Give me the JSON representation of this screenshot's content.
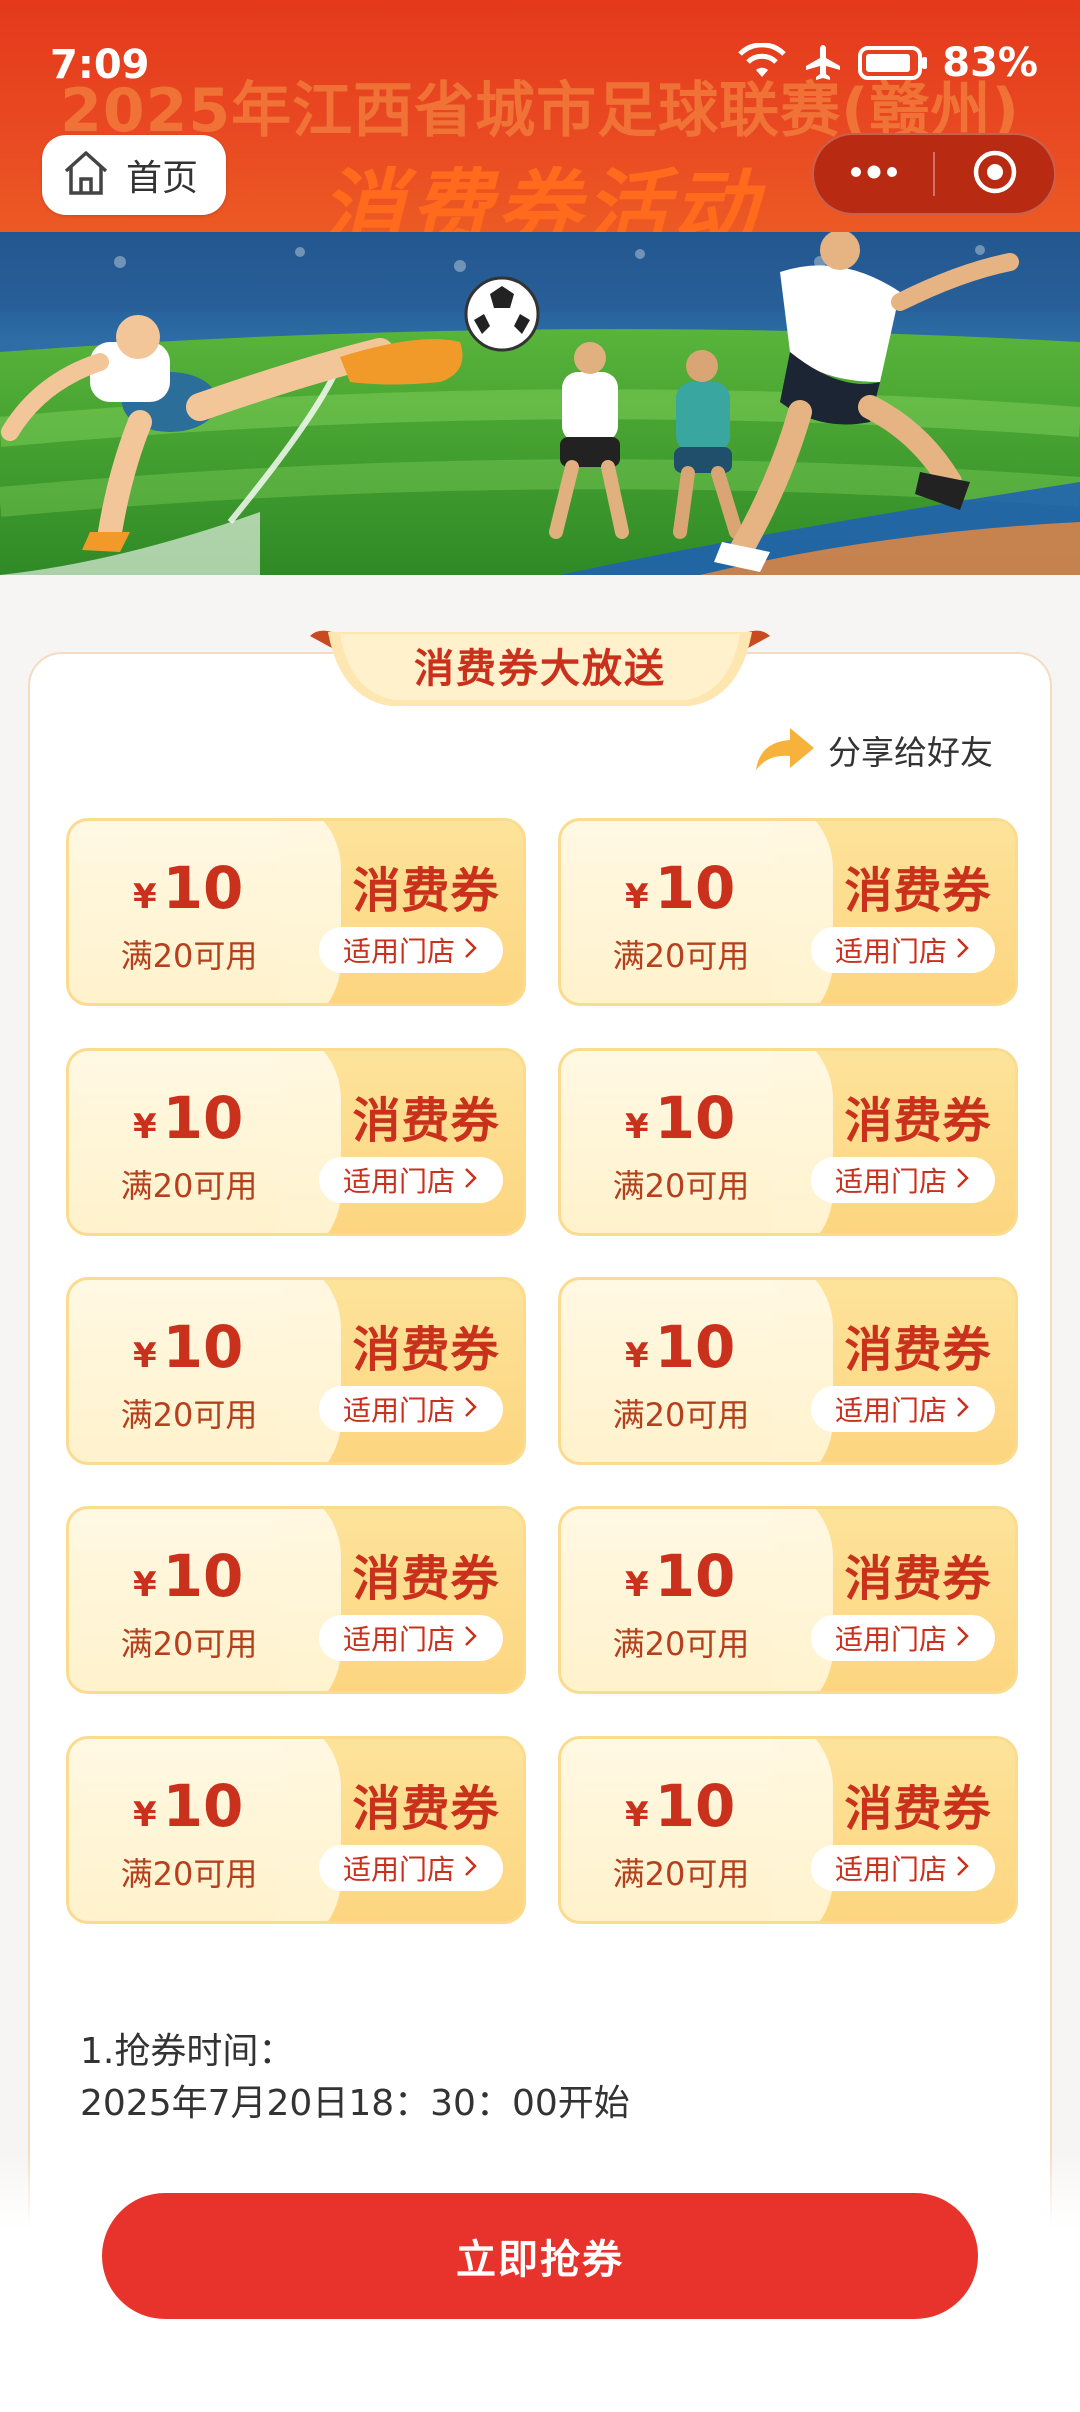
{
  "status_bar": {
    "time": "7:09",
    "battery": "83%"
  },
  "header": {
    "title_line1": "2025年江西省城市足球联赛(赣州)",
    "title_line2": "消费券活动",
    "home_label": "首页"
  },
  "colors": {
    "primary_red": "#e8332c",
    "banner_orange": "#e94a22",
    "coupon_gold": "#fdd580",
    "coupon_text": "#c9311c"
  },
  "section": {
    "ribbon_title": "消费券大放送",
    "share_label": "分享给好友"
  },
  "coupons": [
    {
      "symbol": "¥",
      "amount": "10",
      "condition": "满20可用",
      "title": "消费券",
      "store_link": "适用门店"
    },
    {
      "symbol": "¥",
      "amount": "10",
      "condition": "满20可用",
      "title": "消费券",
      "store_link": "适用门店"
    },
    {
      "symbol": "¥",
      "amount": "10",
      "condition": "满20可用",
      "title": "消费券",
      "store_link": "适用门店"
    },
    {
      "symbol": "¥",
      "amount": "10",
      "condition": "满20可用",
      "title": "消费券",
      "store_link": "适用门店"
    },
    {
      "symbol": "¥",
      "amount": "10",
      "condition": "满20可用",
      "title": "消费券",
      "store_link": "适用门店"
    },
    {
      "symbol": "¥",
      "amount": "10",
      "condition": "满20可用",
      "title": "消费券",
      "store_link": "适用门店"
    },
    {
      "symbol": "¥",
      "amount": "10",
      "condition": "满20可用",
      "title": "消费券",
      "store_link": "适用门店"
    },
    {
      "symbol": "¥",
      "amount": "10",
      "condition": "满20可用",
      "title": "消费券",
      "store_link": "适用门店"
    },
    {
      "symbol": "¥",
      "amount": "10",
      "condition": "满20可用",
      "title": "消费券",
      "store_link": "适用门店"
    },
    {
      "symbol": "¥",
      "amount": "10",
      "condition": "满20可用",
      "title": "消费券",
      "store_link": "适用门店"
    }
  ],
  "rules": {
    "line1": "1.抢券时间：",
    "line2": "2025年7月20日18：30：00开始"
  },
  "cta": {
    "label": "立即抢券"
  },
  "icons": {
    "status": [
      "wifi-icon",
      "airplane-icon",
      "battery-icon"
    ],
    "nav": [
      "home-icon",
      "more-dots-icon",
      "close-target-icon"
    ],
    "share": "share-arrow-icon",
    "store_link": "chevron-right-icon"
  }
}
